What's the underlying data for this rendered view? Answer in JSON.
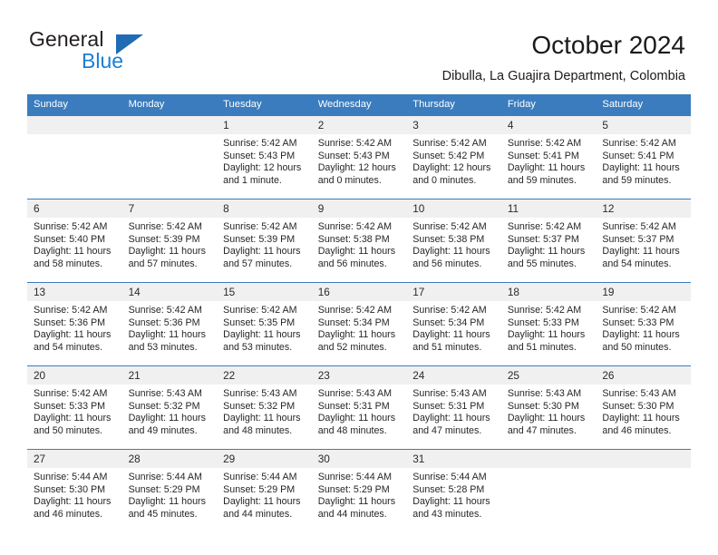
{
  "brand": {
    "name_top": "General",
    "name_bottom": "Blue",
    "triangle_color": "#1f6cb4",
    "blue_text_color": "#1a7fd4"
  },
  "header": {
    "title": "October 2024",
    "subtitle": "Dibulla, La Guajira Department, Colombia"
  },
  "calendar": {
    "accent_color": "#3a7cbe",
    "daynumber_band_color": "#f0f0f0",
    "weekdays": [
      "Sunday",
      "Monday",
      "Tuesday",
      "Wednesday",
      "Thursday",
      "Friday",
      "Saturday"
    ],
    "weeks": [
      [
        {
          "day": "",
          "sunrise": "",
          "sunset": "",
          "daylight1": "",
          "daylight2": ""
        },
        {
          "day": "",
          "sunrise": "",
          "sunset": "",
          "daylight1": "",
          "daylight2": ""
        },
        {
          "day": "1",
          "sunrise": "Sunrise: 5:42 AM",
          "sunset": "Sunset: 5:43 PM",
          "daylight1": "Daylight: 12 hours",
          "daylight2": "and 1 minute."
        },
        {
          "day": "2",
          "sunrise": "Sunrise: 5:42 AM",
          "sunset": "Sunset: 5:43 PM",
          "daylight1": "Daylight: 12 hours",
          "daylight2": "and 0 minutes."
        },
        {
          "day": "3",
          "sunrise": "Sunrise: 5:42 AM",
          "sunset": "Sunset: 5:42 PM",
          "daylight1": "Daylight: 12 hours",
          "daylight2": "and 0 minutes."
        },
        {
          "day": "4",
          "sunrise": "Sunrise: 5:42 AM",
          "sunset": "Sunset: 5:41 PM",
          "daylight1": "Daylight: 11 hours",
          "daylight2": "and 59 minutes."
        },
        {
          "day": "5",
          "sunrise": "Sunrise: 5:42 AM",
          "sunset": "Sunset: 5:41 PM",
          "daylight1": "Daylight: 11 hours",
          "daylight2": "and 59 minutes."
        }
      ],
      [
        {
          "day": "6",
          "sunrise": "Sunrise: 5:42 AM",
          "sunset": "Sunset: 5:40 PM",
          "daylight1": "Daylight: 11 hours",
          "daylight2": "and 58 minutes."
        },
        {
          "day": "7",
          "sunrise": "Sunrise: 5:42 AM",
          "sunset": "Sunset: 5:39 PM",
          "daylight1": "Daylight: 11 hours",
          "daylight2": "and 57 minutes."
        },
        {
          "day": "8",
          "sunrise": "Sunrise: 5:42 AM",
          "sunset": "Sunset: 5:39 PM",
          "daylight1": "Daylight: 11 hours",
          "daylight2": "and 57 minutes."
        },
        {
          "day": "9",
          "sunrise": "Sunrise: 5:42 AM",
          "sunset": "Sunset: 5:38 PM",
          "daylight1": "Daylight: 11 hours",
          "daylight2": "and 56 minutes."
        },
        {
          "day": "10",
          "sunrise": "Sunrise: 5:42 AM",
          "sunset": "Sunset: 5:38 PM",
          "daylight1": "Daylight: 11 hours",
          "daylight2": "and 56 minutes."
        },
        {
          "day": "11",
          "sunrise": "Sunrise: 5:42 AM",
          "sunset": "Sunset: 5:37 PM",
          "daylight1": "Daylight: 11 hours",
          "daylight2": "and 55 minutes."
        },
        {
          "day": "12",
          "sunrise": "Sunrise: 5:42 AM",
          "sunset": "Sunset: 5:37 PM",
          "daylight1": "Daylight: 11 hours",
          "daylight2": "and 54 minutes."
        }
      ],
      [
        {
          "day": "13",
          "sunrise": "Sunrise: 5:42 AM",
          "sunset": "Sunset: 5:36 PM",
          "daylight1": "Daylight: 11 hours",
          "daylight2": "and 54 minutes."
        },
        {
          "day": "14",
          "sunrise": "Sunrise: 5:42 AM",
          "sunset": "Sunset: 5:36 PM",
          "daylight1": "Daylight: 11 hours",
          "daylight2": "and 53 minutes."
        },
        {
          "day": "15",
          "sunrise": "Sunrise: 5:42 AM",
          "sunset": "Sunset: 5:35 PM",
          "daylight1": "Daylight: 11 hours",
          "daylight2": "and 53 minutes."
        },
        {
          "day": "16",
          "sunrise": "Sunrise: 5:42 AM",
          "sunset": "Sunset: 5:34 PM",
          "daylight1": "Daylight: 11 hours",
          "daylight2": "and 52 minutes."
        },
        {
          "day": "17",
          "sunrise": "Sunrise: 5:42 AM",
          "sunset": "Sunset: 5:34 PM",
          "daylight1": "Daylight: 11 hours",
          "daylight2": "and 51 minutes."
        },
        {
          "day": "18",
          "sunrise": "Sunrise: 5:42 AM",
          "sunset": "Sunset: 5:33 PM",
          "daylight1": "Daylight: 11 hours",
          "daylight2": "and 51 minutes."
        },
        {
          "day": "19",
          "sunrise": "Sunrise: 5:42 AM",
          "sunset": "Sunset: 5:33 PM",
          "daylight1": "Daylight: 11 hours",
          "daylight2": "and 50 minutes."
        }
      ],
      [
        {
          "day": "20",
          "sunrise": "Sunrise: 5:42 AM",
          "sunset": "Sunset: 5:33 PM",
          "daylight1": "Daylight: 11 hours",
          "daylight2": "and 50 minutes."
        },
        {
          "day": "21",
          "sunrise": "Sunrise: 5:43 AM",
          "sunset": "Sunset: 5:32 PM",
          "daylight1": "Daylight: 11 hours",
          "daylight2": "and 49 minutes."
        },
        {
          "day": "22",
          "sunrise": "Sunrise: 5:43 AM",
          "sunset": "Sunset: 5:32 PM",
          "daylight1": "Daylight: 11 hours",
          "daylight2": "and 48 minutes."
        },
        {
          "day": "23",
          "sunrise": "Sunrise: 5:43 AM",
          "sunset": "Sunset: 5:31 PM",
          "daylight1": "Daylight: 11 hours",
          "daylight2": "and 48 minutes."
        },
        {
          "day": "24",
          "sunrise": "Sunrise: 5:43 AM",
          "sunset": "Sunset: 5:31 PM",
          "daylight1": "Daylight: 11 hours",
          "daylight2": "and 47 minutes."
        },
        {
          "day": "25",
          "sunrise": "Sunrise: 5:43 AM",
          "sunset": "Sunset: 5:30 PM",
          "daylight1": "Daylight: 11 hours",
          "daylight2": "and 47 minutes."
        },
        {
          "day": "26",
          "sunrise": "Sunrise: 5:43 AM",
          "sunset": "Sunset: 5:30 PM",
          "daylight1": "Daylight: 11 hours",
          "daylight2": "and 46 minutes."
        }
      ],
      [
        {
          "day": "27",
          "sunrise": "Sunrise: 5:44 AM",
          "sunset": "Sunset: 5:30 PM",
          "daylight1": "Daylight: 11 hours",
          "daylight2": "and 46 minutes."
        },
        {
          "day": "28",
          "sunrise": "Sunrise: 5:44 AM",
          "sunset": "Sunset: 5:29 PM",
          "daylight1": "Daylight: 11 hours",
          "daylight2": "and 45 minutes."
        },
        {
          "day": "29",
          "sunrise": "Sunrise: 5:44 AM",
          "sunset": "Sunset: 5:29 PM",
          "daylight1": "Daylight: 11 hours",
          "daylight2": "and 44 minutes."
        },
        {
          "day": "30",
          "sunrise": "Sunrise: 5:44 AM",
          "sunset": "Sunset: 5:29 PM",
          "daylight1": "Daylight: 11 hours",
          "daylight2": "and 44 minutes."
        },
        {
          "day": "31",
          "sunrise": "Sunrise: 5:44 AM",
          "sunset": "Sunset: 5:28 PM",
          "daylight1": "Daylight: 11 hours",
          "daylight2": "and 43 minutes."
        },
        {
          "day": "",
          "sunrise": "",
          "sunset": "",
          "daylight1": "",
          "daylight2": ""
        },
        {
          "day": "",
          "sunrise": "",
          "sunset": "",
          "daylight1": "",
          "daylight2": ""
        }
      ]
    ]
  }
}
